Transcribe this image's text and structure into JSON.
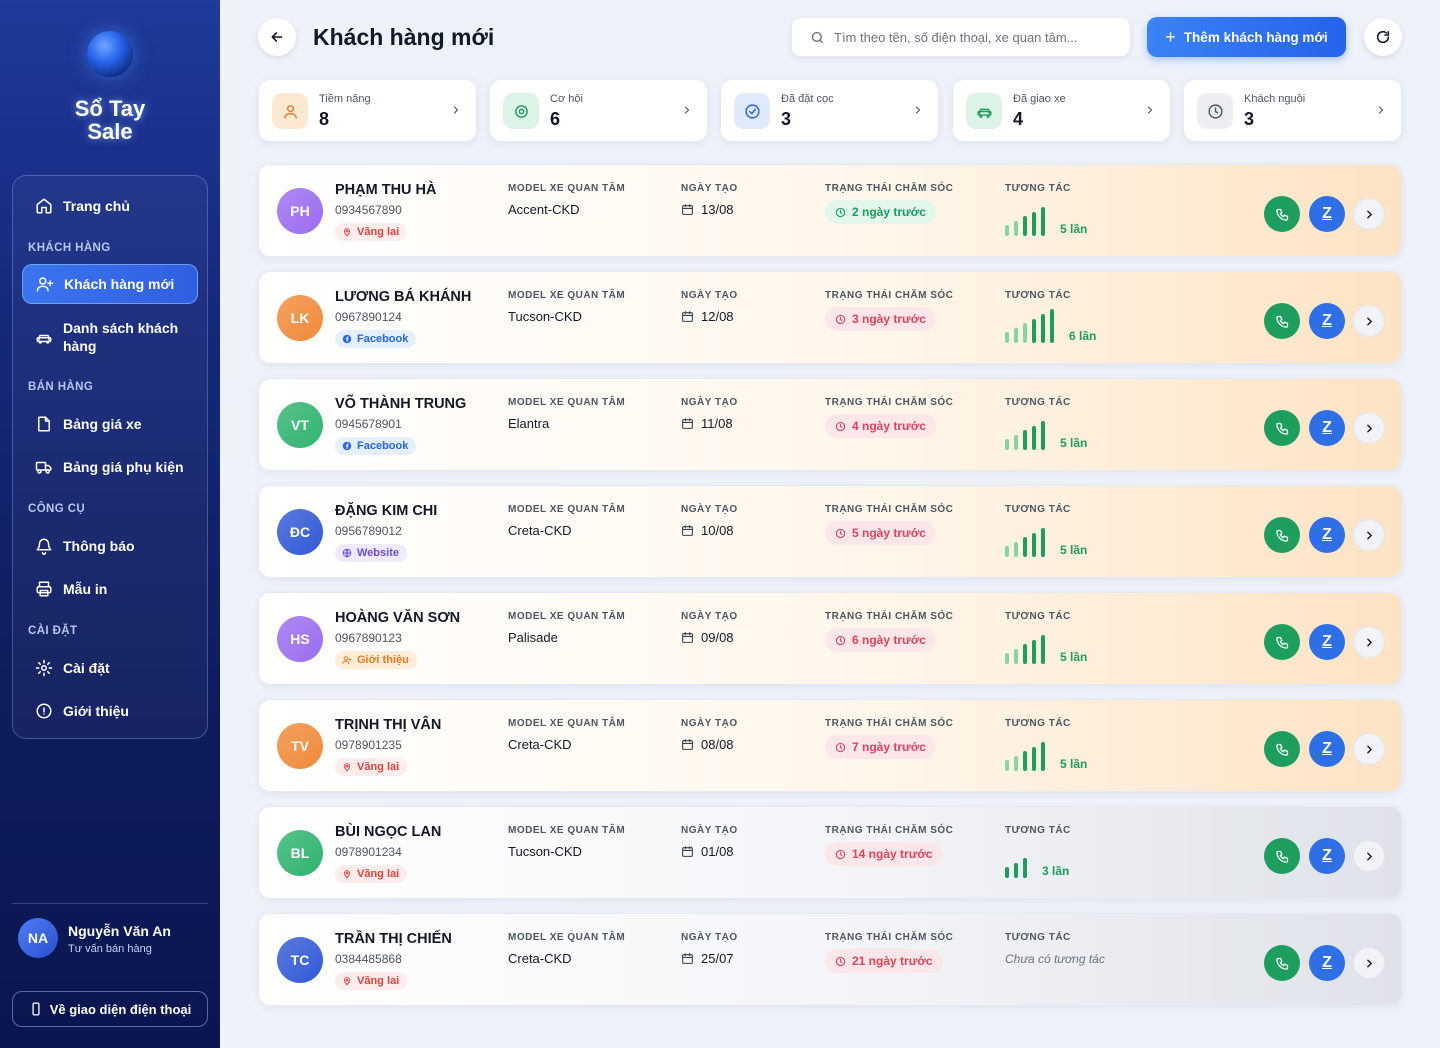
{
  "app": {
    "logo_text": "Sổ Tay\nSale"
  },
  "sidebar": {
    "home": "Trang chủ",
    "sections": {
      "customers": "KHÁCH HÀNG",
      "sales": "BÁN HÀNG",
      "tools": "CÔNG CỤ",
      "settings": "CÀI ĐẶT"
    },
    "items": {
      "new_customers": "Khách hàng mới",
      "customer_list": "Danh sách khách hàng",
      "car_prices": "Bảng giá xe",
      "accessory_prices": "Bảng giá phụ kiện",
      "notifications": "Thông báo",
      "print_templates": "Mẫu in",
      "settings": "Cài đặt",
      "about": "Giới thiệu"
    },
    "user": {
      "initials": "NA",
      "name": "Nguyễn Văn An",
      "role": "Tư vấn bán hàng"
    },
    "phone_view": "Về giao diện điện thoại"
  },
  "header": {
    "title": "Khách hàng mới",
    "search_placeholder": "Tìm theo tên, số điện thoại, xe quan tâm...",
    "add_label": "Thêm khách hàng mới"
  },
  "stats": [
    {
      "label": "Tiềm năng",
      "value": "8",
      "icon": "user-icon",
      "bg": "#fde9d2",
      "color": "#e07b2a"
    },
    {
      "label": "Cơ hội",
      "value": "6",
      "icon": "target-icon",
      "bg": "#dcf3e6",
      "color": "#1e9e5e"
    },
    {
      "label": "Đã đặt cọc",
      "value": "3",
      "icon": "check-circle-icon",
      "bg": "#dfeaff",
      "color": "#2563eb"
    },
    {
      "label": "Đã giao xe",
      "value": "4",
      "icon": "car-icon",
      "bg": "#dcf3e6",
      "color": "#1e9e5e"
    },
    {
      "label": "Khách nguội",
      "value": "3",
      "icon": "clock-icon",
      "bg": "#eceef2",
      "color": "#4b5563"
    }
  ],
  "columns": {
    "model": "MODEL XE QUAN TÂM",
    "created": "NGÀY TẠO",
    "care": "TRẠNG THÁI CHĂM SÓC",
    "interaction": "TƯƠNG TÁC"
  },
  "customers": [
    {
      "initials": "PH",
      "name": "PHẠM THU HÀ",
      "phone": "0934567890",
      "source": "Vãng lai",
      "model": "Accent-CKD",
      "date": "13/08",
      "care": "2 ngày trước",
      "care_level": "green",
      "bars": 5,
      "interaction": "5 lần",
      "avatar": "#9b6cf0"
    },
    {
      "initials": "LK",
      "name": "LƯƠNG BÁ KHÁNH",
      "phone": "0967890124",
      "source": "Facebook",
      "model": "Tucson-CKD",
      "date": "12/08",
      "care": "3 ngày trước",
      "care_level": "red",
      "bars": 6,
      "interaction": "6 lần",
      "avatar": "#f08a3a"
    },
    {
      "initials": "VT",
      "name": "VÕ THÀNH TRUNG",
      "phone": "0945678901",
      "source": "Facebook",
      "model": "Elantra",
      "date": "11/08",
      "care": "4 ngày trước",
      "care_level": "red",
      "bars": 5,
      "interaction": "5 lần",
      "avatar": "#2fb36f"
    },
    {
      "initials": "ĐC",
      "name": "ĐẶNG KIM CHI",
      "phone": "0956789012",
      "source": "Website",
      "model": "Creta-CKD",
      "date": "10/08",
      "care": "5 ngày trước",
      "care_level": "red",
      "bars": 5,
      "interaction": "5 lần",
      "avatar": "#3159d6"
    },
    {
      "initials": "HS",
      "name": "HOÀNG VĂN SƠN",
      "phone": "0967890123",
      "source": "Giới thiệu",
      "model": "Palisade",
      "date": "09/08",
      "care": "6 ngày trước",
      "care_level": "red",
      "bars": 5,
      "interaction": "5 lần",
      "avatar": "#9b6cf0"
    },
    {
      "initials": "TV",
      "name": "TRỊNH THỊ VÂN",
      "phone": "0978901235",
      "source": "Vãng lai",
      "model": "Creta-CKD",
      "date": "08/08",
      "care": "7 ngày trước",
      "care_level": "red",
      "bars": 5,
      "interaction": "5 lần",
      "avatar": "#f08a3a"
    },
    {
      "initials": "BL",
      "name": "BÙI NGỌC LAN",
      "phone": "0978901234",
      "source": "Vãng lai",
      "model": "Tucson-CKD",
      "date": "01/08",
      "care": "14 ngày trước",
      "care_level": "red",
      "bars": 3,
      "interaction": "3 lần",
      "avatar": "#2fb36f"
    },
    {
      "initials": "TC",
      "name": "TRẦN THỊ CHIẾN",
      "phone": "0384485868",
      "source": "Vãng lai",
      "model": "Creta-CKD",
      "date": "25/07",
      "care": "21 ngày trước",
      "care_level": "red",
      "bars": 0,
      "interaction": "Chưa có tương tác",
      "avatar": "#3159d6"
    }
  ]
}
